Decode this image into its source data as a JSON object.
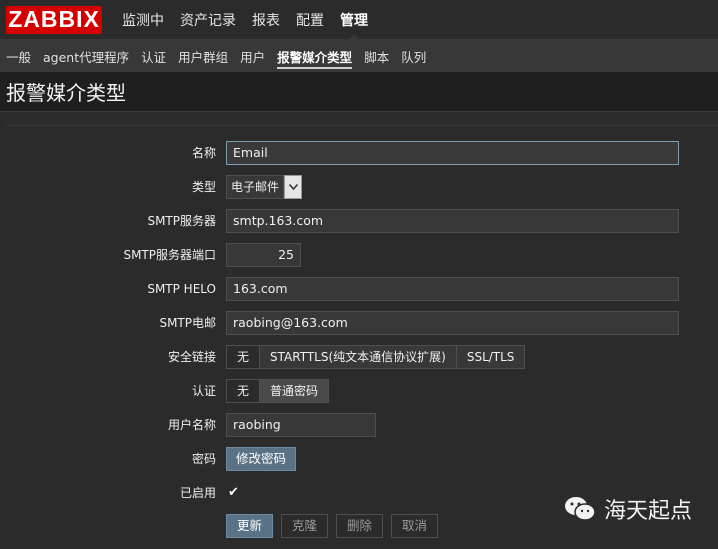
{
  "brand": "ZABBIX",
  "topnav": [
    "监测中",
    "资产记录",
    "报表",
    "配置",
    "管理"
  ],
  "subnav": [
    "一般",
    "agent代理程序",
    "认证",
    "用户群组",
    "用户",
    "报警媒介类型",
    "脚本",
    "队列"
  ],
  "page_title": "报警媒介类型",
  "form": {
    "name_label": "名称",
    "name_value": "Email",
    "type_label": "类型",
    "type_value": "电子邮件",
    "smtp_server_label": "SMTP服务器",
    "smtp_server_value": "smtp.163.com",
    "smtp_port_label": "SMTP服务器端口",
    "smtp_port_value": "25",
    "smtp_helo_label": "SMTP HELO",
    "smtp_helo_value": "163.com",
    "smtp_email_label": "SMTP电邮",
    "smtp_email_value": "raobing@163.com",
    "security_label": "安全链接",
    "security_options": [
      "无",
      "STARTTLS(纯文本通信协议扩展)",
      "SSL/TLS"
    ],
    "auth_label": "认证",
    "auth_options": [
      "无",
      "普通密码"
    ],
    "username_label": "用户名称",
    "username_value": "raobing",
    "password_label": "密码",
    "password_button": "修改密码",
    "enabled_label": "已启用",
    "enabled_mark": "✔"
  },
  "buttons": {
    "update": "更新",
    "clone": "克隆",
    "delete": "删除",
    "cancel": "取消"
  },
  "watermark": "海天起点",
  "colors": {
    "brand_red": "#d40000",
    "accent_blue": "#5a7286"
  }
}
